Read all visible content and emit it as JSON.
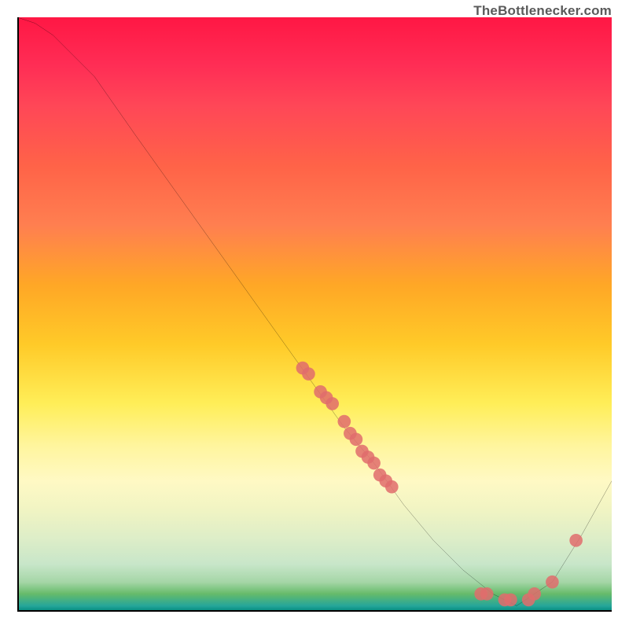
{
  "watermark": "TheBottlenecker.com",
  "colors": {
    "accent_point": "#e06c6c",
    "curve": "#000000",
    "gradient_top": "#ff1744",
    "gradient_bottom": "#00897b"
  },
  "chart_data": {
    "type": "line",
    "title": "",
    "xlabel": "",
    "ylabel": "",
    "xlim": [
      0,
      100
    ],
    "ylim": [
      0,
      100
    ],
    "series": [
      {
        "name": "bottleneck-curve",
        "x": [
          0,
          3,
          6,
          9,
          13,
          20,
          30,
          40,
          50,
          55,
          60,
          65,
          70,
          75,
          80,
          84,
          90,
          95,
          100
        ],
        "y": [
          100,
          99,
          97,
          94,
          90,
          80,
          66,
          52,
          38,
          31,
          25,
          18,
          12,
          7,
          3,
          1,
          5,
          13,
          22
        ]
      }
    ],
    "highlight_points": [
      {
        "x": 48,
        "y": 41
      },
      {
        "x": 49,
        "y": 40
      },
      {
        "x": 51,
        "y": 37
      },
      {
        "x": 52,
        "y": 36
      },
      {
        "x": 53,
        "y": 35
      },
      {
        "x": 55,
        "y": 32
      },
      {
        "x": 56,
        "y": 30
      },
      {
        "x": 57,
        "y": 29
      },
      {
        "x": 58,
        "y": 27
      },
      {
        "x": 59,
        "y": 26
      },
      {
        "x": 60,
        "y": 25
      },
      {
        "x": 61,
        "y": 23
      },
      {
        "x": 62,
        "y": 22
      },
      {
        "x": 63,
        "y": 21
      },
      {
        "x": 78,
        "y": 3
      },
      {
        "x": 79,
        "y": 3
      },
      {
        "x": 82,
        "y": 2
      },
      {
        "x": 83,
        "y": 2
      },
      {
        "x": 86,
        "y": 2
      },
      {
        "x": 87,
        "y": 3
      },
      {
        "x": 90,
        "y": 5
      },
      {
        "x": 94,
        "y": 12
      }
    ]
  }
}
